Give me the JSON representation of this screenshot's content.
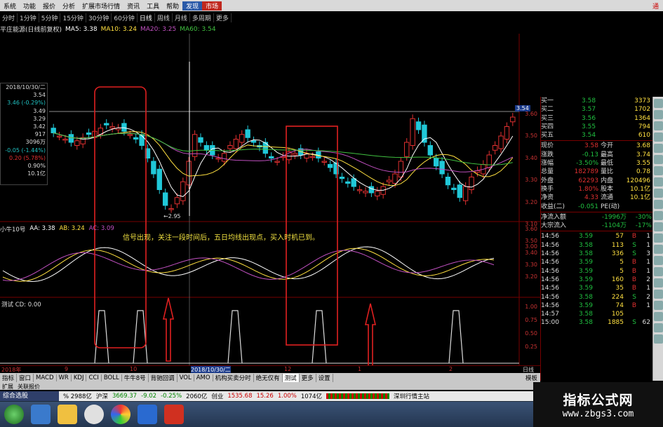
{
  "menu": {
    "items": [
      "系统",
      "功能",
      "报价",
      "分析",
      "扩展市场行情",
      "资讯",
      "工具",
      "帮助"
    ],
    "highlight": [
      "发现",
      "市场"
    ],
    "right": "通"
  },
  "periods": [
    "分时",
    "1分钟",
    "5分钟",
    "15分钟",
    "30分钟",
    "60分钟",
    "日线",
    "周线",
    "月线",
    "多周期",
    "更多"
  ],
  "title": {
    "stock": "平庄能源(日线前复权)",
    "ma5": "MA5: 3.38",
    "ma10": "MA10: 3.24",
    "ma20": "MA20: 3.25",
    "ma60": "MA60: 3.54"
  },
  "info_box": [
    "2018/10/30/二",
    "3.54",
    "3.46 (-0.29%)",
    "3.49",
    "3.29",
    "3.42",
    "917",
    "3096万",
    "-0.05 (-1.44%)",
    "0.20 (5.78%)",
    "0.90%",
    "10.1亿"
  ],
  "main_axis": [
    "3.60",
    "3.50",
    "3.40",
    "3.30",
    "3.20",
    "3.10",
    "3.00"
  ],
  "price_tag": "3.54",
  "low_label": "←2.95",
  "sub1_title": {
    "name": "小牛10号",
    "aa": "AA: 3.38",
    "ab": "AB: 3.24",
    "ac": "AC: 3.09"
  },
  "sub1_axis": [
    "3.60",
    "3.50",
    "3.40",
    "3.30",
    "3.20"
  ],
  "annotation": "信号出现，关注一段时间后，五日均线出现点，买入时机已到。",
  "sub2_title": "测试 CD: 0.00",
  "sub2_axis": [
    "1.00",
    "0.75",
    "0.50",
    "0.25"
  ],
  "x_labels": [
    "2018年",
    "9",
    "10",
    "2018/10/30/二",
    "12",
    "1",
    "2"
  ],
  "x_right": "日线",
  "quote": {
    "bids": [
      {
        "label": "买一",
        "price": "3.58",
        "vol": "3373"
      },
      {
        "label": "买二",
        "price": "3.57",
        "vol": "1702"
      },
      {
        "label": "买三",
        "price": "3.56",
        "vol": "1364"
      },
      {
        "label": "买四",
        "price": "3.55",
        "vol": "794"
      },
      {
        "label": "买五",
        "price": "3.54",
        "vol": "610"
      }
    ],
    "stats": [
      [
        "现价",
        "3.58",
        "今开",
        "3.68"
      ],
      [
        "涨跌",
        "-0.13",
        "最高",
        "3.74"
      ],
      [
        "涨幅",
        "-3.50%",
        "最低",
        "3.55"
      ],
      [
        "总量",
        "182789",
        "量比",
        "0.78"
      ],
      [
        "外盘",
        "62293",
        "内盘",
        "120496"
      ],
      [
        "换手",
        "1.80%",
        "股本",
        "10.1亿"
      ],
      [
        "净资",
        "4.33",
        "流通",
        "10.1亿"
      ],
      [
        "收益(二)",
        "-0.051",
        "PE(动)",
        ""
      ]
    ],
    "flows": [
      [
        "净流入额",
        "-1996万",
        "-30%"
      ],
      [
        "大宗流入",
        "-1104万",
        "-17%"
      ]
    ],
    "ticks": [
      [
        "14:56",
        "3.59",
        "57",
        "B",
        "1"
      ],
      [
        "14:56",
        "3.58",
        "113",
        "S",
        "1"
      ],
      [
        "14:56",
        "3.58",
        "336",
        "S",
        "3"
      ],
      [
        "14:56",
        "3.59",
        "5",
        "B",
        "1"
      ],
      [
        "14:56",
        "3.59",
        "5",
        "B",
        "1"
      ],
      [
        "14:56",
        "3.59",
        "160",
        "B",
        "2"
      ],
      [
        "14:56",
        "3.59",
        "35",
        "B",
        "1"
      ],
      [
        "14:56",
        "3.58",
        "224",
        "S",
        "2"
      ],
      [
        "14:56",
        "3.59",
        "74",
        "B",
        "1"
      ],
      [
        "14:57",
        "3.58",
        "105",
        "",
        ""
      ],
      [
        "15:00",
        "3.58",
        "1885",
        "S",
        "62"
      ]
    ]
  },
  "tabs": [
    "指标",
    "窗口",
    "MACD",
    "WR",
    "KDJ",
    "CCI",
    "BOLL",
    "牛牛8号",
    "背驰回调",
    "VOL",
    "AMO",
    "机构买卖分时",
    "绝无仅有",
    "测试",
    "更多",
    "设置"
  ],
  "tabs_right": "模板",
  "tabs2": [
    "扩展",
    "关联报价"
  ],
  "ticker": {
    "left": "综合选股",
    "sh_label": "沪深",
    "sh_val": "3669.37",
    "sh_chg": "-9.02",
    "sh_pct": "-0.25%",
    "sh_amt": "2060亿",
    "cy_label": "创业",
    "cy_val": "1535.68",
    "cy_chg": "15.26",
    "cy_pct": "1.00%",
    "cy_amt": "1074亿",
    "extra": "% 2988亿",
    "right": "深圳行情主站"
  },
  "brand": {
    "cn": "指标公式网",
    "url": "www.zbgs3.com"
  },
  "colors": {
    "up": "#e03030",
    "down": "#20c8d8",
    "ma5": "#ffffff",
    "ma10": "#ffe040",
    "ma20": "#c050c0",
    "ma60": "#40c040"
  }
}
